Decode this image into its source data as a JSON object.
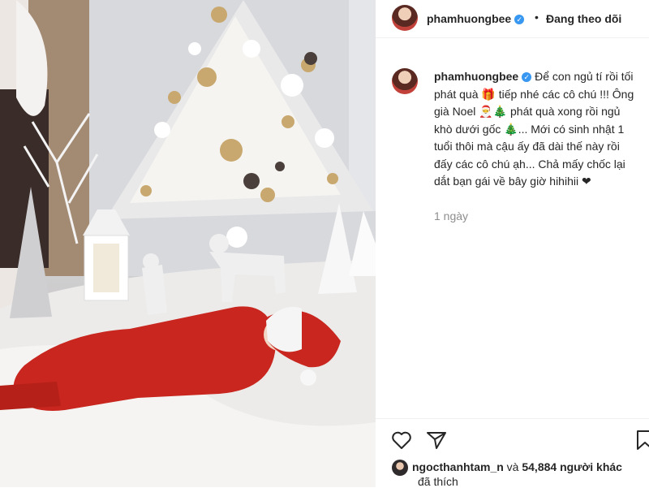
{
  "post": {
    "username": "phamhuongbee",
    "header_dot": "•",
    "follow_label": "Đang theo dõi",
    "caption_username": "phamhuongbee",
    "caption_text": "Để con ngủ tí rồi tối phát quà 🎁 tiếp nhé các cô chú !!! Ông già Noel 🎅🎄 phát quà xong rồi ngủ khò dưới gốc 🎄... Mới có sinh nhật 1 tuổi thôi mà cậu ấy đã dài thế này rồi đấy các cô chú ạh... Chả mấy chốc lại dắt bạn gái về bây giờ hihihii ❤",
    "time_ago": "1 ngày"
  },
  "likes": {
    "liked_by_user": "ngocthanhtam_n",
    "connector": " và ",
    "others_count_text": "54,884 người khác",
    "suffix": "đã thích"
  },
  "icons": {
    "verified": "verified-badge-icon",
    "like": "heart-icon",
    "share": "paper-plane-icon",
    "save": "bookmark-icon"
  },
  "colors": {
    "verified": "#3897f0",
    "secondary_text": "#8e8e8e",
    "primary_text": "#262626",
    "suit_red": "#c8261e"
  }
}
